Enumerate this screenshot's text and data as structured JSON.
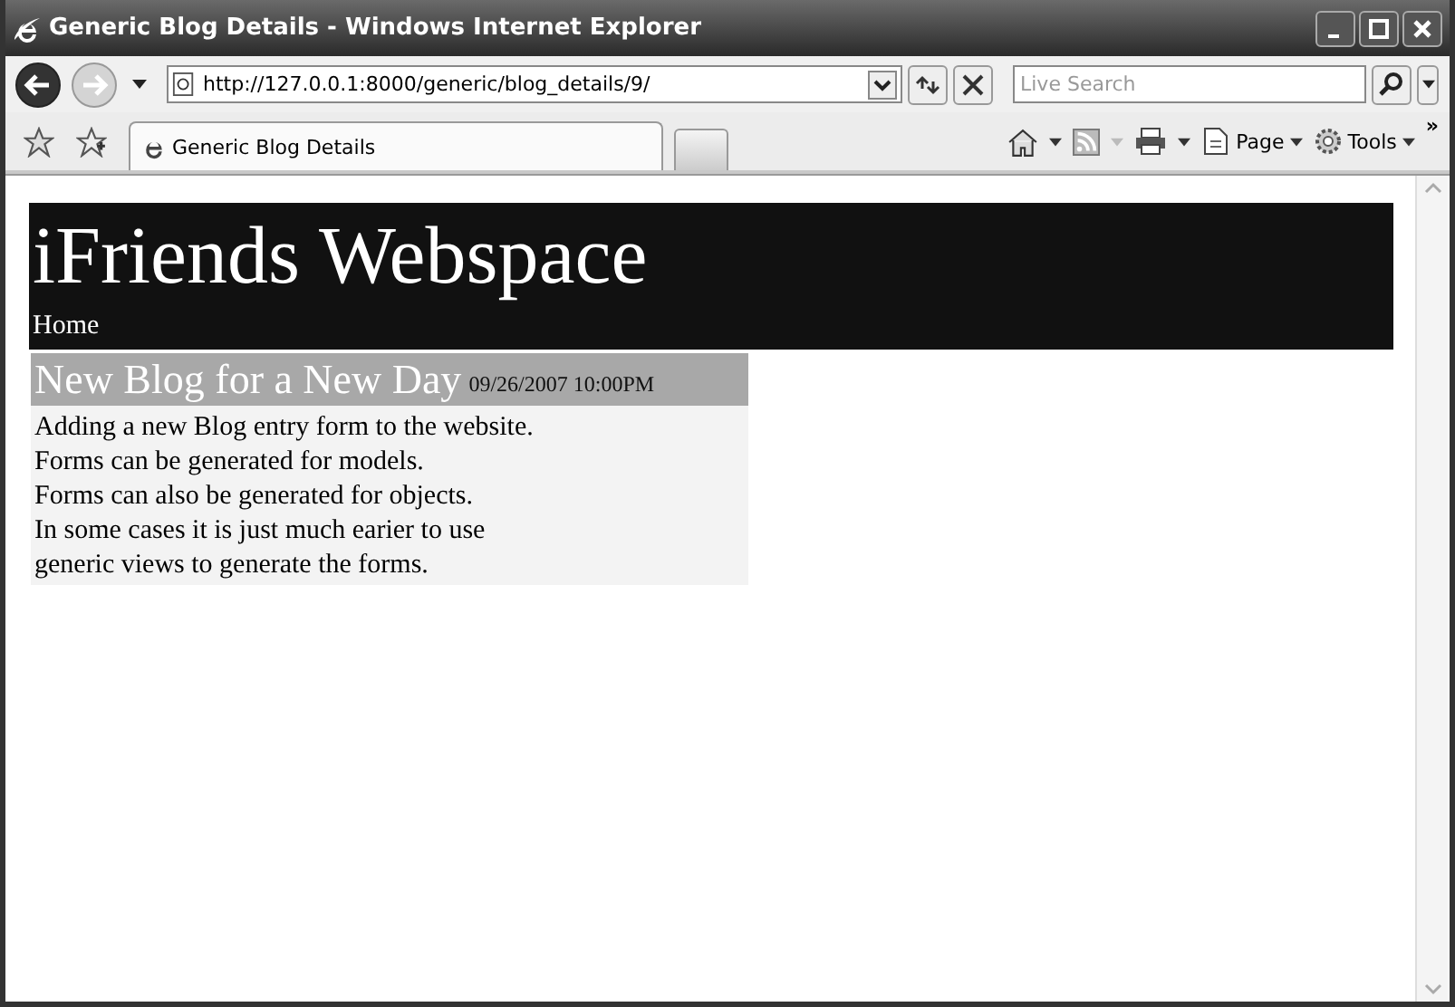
{
  "window": {
    "title": "Generic Blog Details - Windows Internet Explorer"
  },
  "address": {
    "value": "http://127.0.0.1:8000/generic/blog_details/9/"
  },
  "search": {
    "placeholder": "Live Search"
  },
  "tabs": [
    {
      "label": "Generic Blog Details",
      "selected": true
    }
  ],
  "toolbar": [
    {
      "label": "Page"
    },
    {
      "label": "Tools"
    }
  ],
  "overflow": "»",
  "page": {
    "site_title": "iFriends Webspace",
    "nav": [
      "Home"
    ],
    "blog": {
      "title": "New Blog for a New Day",
      "date": "09/26/2007 10:00PM",
      "lines": [
        "Adding a new Blog entry form to the website.",
        "Forms can be generated for models.",
        "Forms can also be generated for objects.",
        "In some cases it is just much earier to use",
        "generic views to generate the forms."
      ]
    }
  }
}
